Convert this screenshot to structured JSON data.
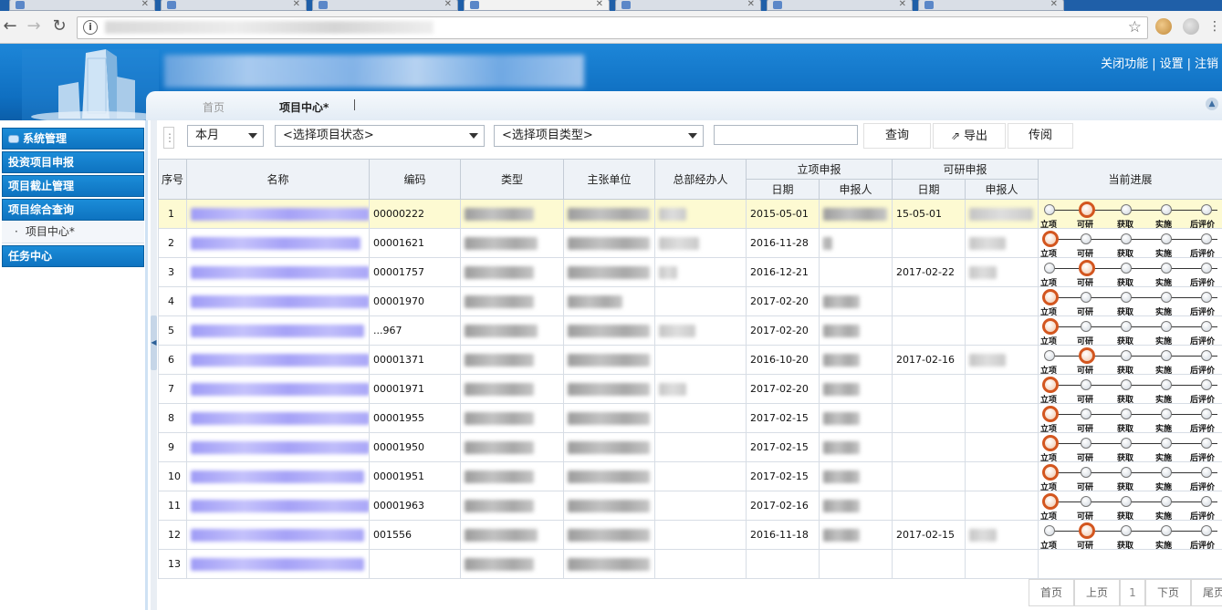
{
  "app": {
    "top_links": [
      "关闭功能",
      "设置",
      "注销"
    ],
    "page_tabs": [
      "首页",
      "项目中心*"
    ]
  },
  "sidebar": {
    "items": [
      {
        "label": "系统管理",
        "icon": "system-icon"
      },
      {
        "label": "投资项目申报"
      },
      {
        "label": "项目截止管理"
      },
      {
        "label": "项目综合查询"
      },
      {
        "label": "项目中心*",
        "sub": true
      },
      {
        "label": "任务中心"
      }
    ]
  },
  "filters": {
    "period": "本月",
    "status": "<选择项目状态>",
    "type": "<选择项目类型>",
    "search_value": "",
    "query_button": "查询",
    "export_button": "导出",
    "circulate_button": "传阅"
  },
  "grid": {
    "headers": {
      "index": "序号",
      "name": "名称",
      "code": "编码",
      "type": "类型",
      "unit": "主张单位",
      "manager": "总部经办人",
      "approval_group": "立项申报",
      "feasibility_group": "可研申报",
      "date": "日期",
      "reporter": "申报人",
      "progress": "当前进展"
    },
    "progress_steps": [
      "立项",
      "可研",
      "获取",
      "实施",
      "后评价"
    ],
    "rows": [
      {
        "index": "1",
        "code": "00000222",
        "approval_date": "2015-05-01",
        "feasibility_date": "15-05-01",
        "stage": 2,
        "selected": true
      },
      {
        "index": "2",
        "code": "00001621",
        "approval_date": "2016-11-28",
        "feasibility_date": "",
        "stage": 1
      },
      {
        "index": "3",
        "code": "00001757",
        "approval_date": "2016-12-21",
        "feasibility_date": "2017-02-22",
        "stage": 2
      },
      {
        "index": "4",
        "code": "00001970",
        "approval_date": "2017-02-20",
        "feasibility_date": "",
        "stage": 1
      },
      {
        "index": "5",
        "code": "...967",
        "approval_date": "2017-02-20",
        "feasibility_date": "",
        "stage": 1
      },
      {
        "index": "6",
        "code": "00001371",
        "approval_date": "2016-10-20",
        "feasibility_date": "2017-02-16",
        "stage": 2
      },
      {
        "index": "7",
        "code": "00001971",
        "approval_date": "2017-02-20",
        "feasibility_date": "",
        "stage": 1
      },
      {
        "index": "8",
        "code": "00001955",
        "approval_date": "2017-02-15",
        "feasibility_date": "",
        "stage": 1
      },
      {
        "index": "9",
        "code": "00001950",
        "approval_date": "2017-02-15",
        "feasibility_date": "",
        "stage": 1
      },
      {
        "index": "10",
        "code": "00001951",
        "approval_date": "2017-02-15",
        "feasibility_date": "",
        "stage": 1
      },
      {
        "index": "11",
        "code": "00001963",
        "approval_date": "2017-02-16",
        "feasibility_date": "",
        "stage": 1
      },
      {
        "index": "12",
        "code": "001556",
        "approval_date": "2016-11-18",
        "feasibility_date": "2017-02-15",
        "stage": 2
      },
      {
        "index": "13",
        "code": "",
        "approval_date": "",
        "feasibility_date": "",
        "stage": 0
      }
    ]
  },
  "pager": {
    "first": "首页",
    "prev": "上页",
    "current_page": "1",
    "next": "下页",
    "last": "尾页"
  },
  "colors": {
    "header_blue": "#0f6fc1",
    "sidebar_blue": "#1b8cd8",
    "active_node": "#d3561f",
    "selected_row": "#fdfad2"
  }
}
